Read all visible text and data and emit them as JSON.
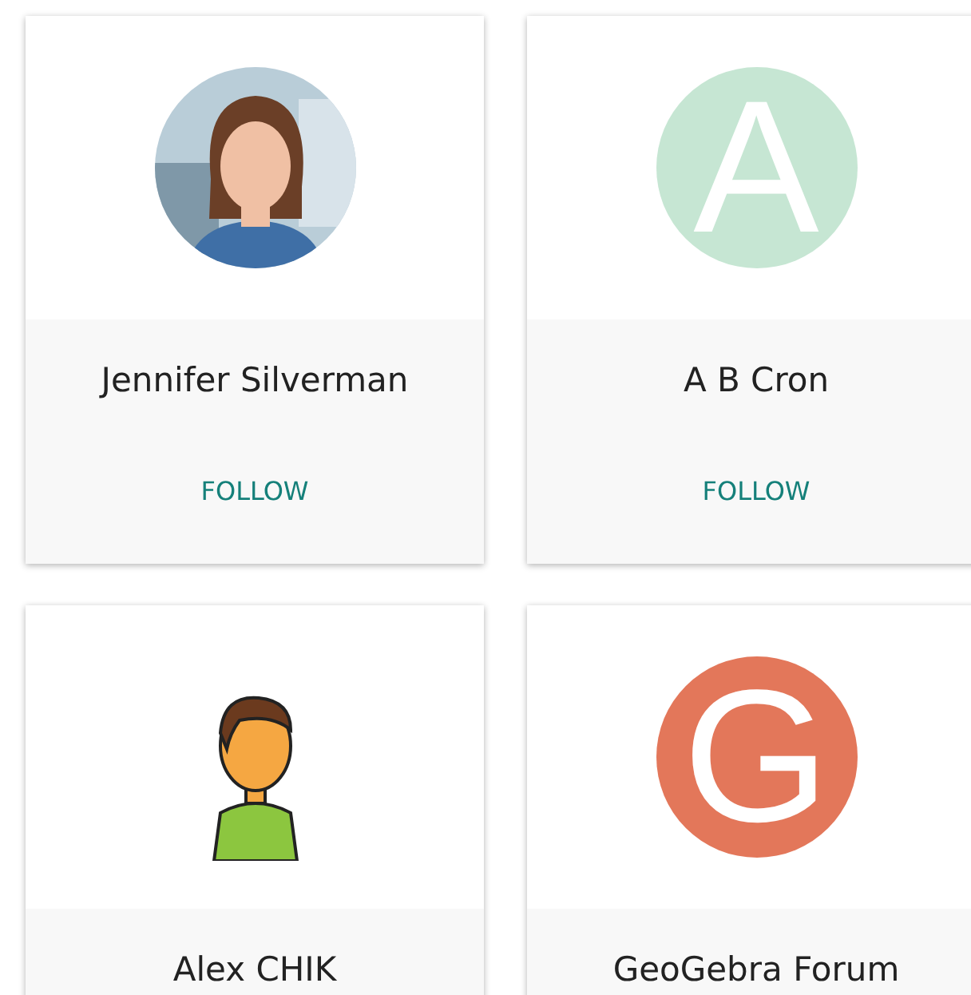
{
  "cards": [
    {
      "name": "Jennifer Silverman",
      "action": "FOLLOW"
    },
    {
      "name": "A B Cron",
      "avatar": {
        "kind": "letter",
        "letter": "A",
        "color": "#c6e6d3"
      },
      "action": "FOLLOW"
    },
    {
      "name": "Alex CHIK",
      "avatar": {
        "kind": "cartoon"
      }
    },
    {
      "name": "GeoGebra Forum",
      "avatar": {
        "kind": "letter",
        "letter": "G",
        "color": "#e3775a"
      }
    }
  ]
}
